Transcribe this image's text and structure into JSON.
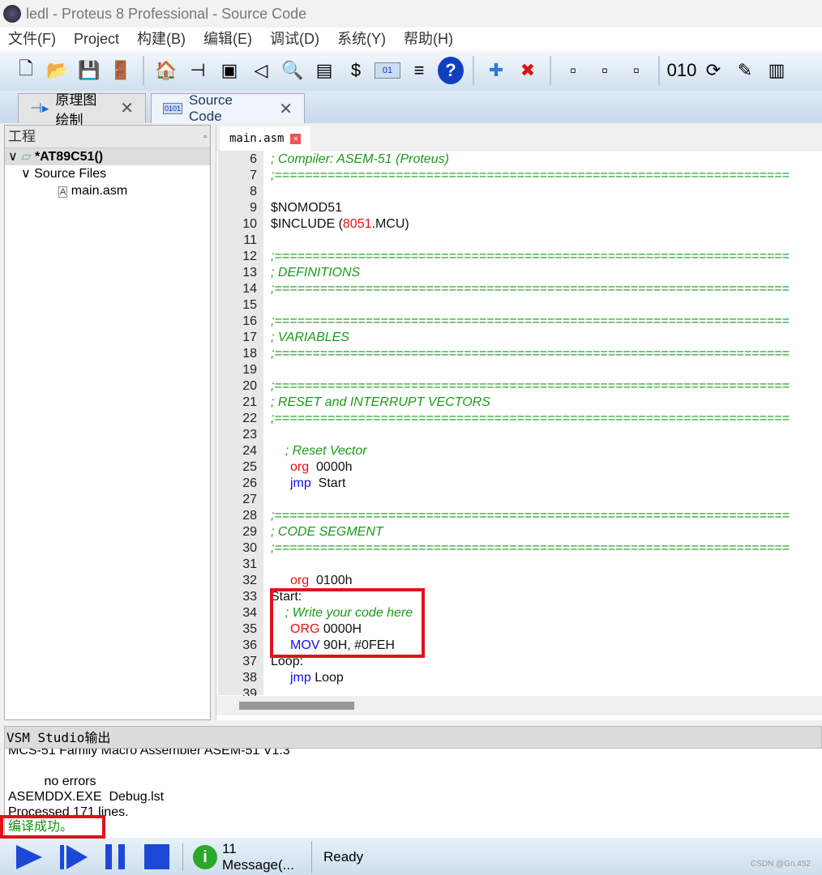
{
  "window": {
    "title": "ledl - Proteus 8 Professional - Source Code"
  },
  "menu": [
    "文件(F)",
    "Project",
    "构建(B)",
    "编辑(E)",
    "调试(D)",
    "系统(Y)",
    "帮助(H)"
  ],
  "toolbar": [
    "new-file",
    "open",
    "save",
    "exit",
    "home",
    "schematic",
    "pcb",
    "3d-view",
    "gerber",
    "bom",
    "design-explorer",
    "source-code",
    "notes",
    "help",
    "add",
    "delete",
    "small-1",
    "small-2",
    "small-3",
    "binary",
    "refresh",
    "tools",
    "chip"
  ],
  "tabs": [
    {
      "label": "原理图绘制",
      "icon": "schematic-icon"
    },
    {
      "label": "Source Code",
      "icon": "binary-icon",
      "active": true
    }
  ],
  "project": {
    "header": "工程",
    "root": "*AT89C51()",
    "folder": "Source Files",
    "file": "main.asm"
  },
  "editor": {
    "file_tab": "main.asm",
    "lines": [
      {
        "n": "6",
        "t": "; Compiler: ASEM-51 (Proteus)",
        "c": "cm"
      },
      {
        "n": "7",
        "t": ";====================================================================",
        "c": "cm"
      },
      {
        "n": "8",
        "t": "",
        "c": ""
      },
      {
        "n": "9",
        "t": "$NOMOD51",
        "c": ""
      },
      {
        "n": "10",
        "t": "$INCLUDE (8051.MCU)",
        "c": ""
      },
      {
        "n": "11",
        "t": "",
        "c": ""
      },
      {
        "n": "12",
        "t": ";====================================================================",
        "c": "cm"
      },
      {
        "n": "13",
        "t": "; DEFINITIONS",
        "c": "cm"
      },
      {
        "n": "14",
        "t": ";====================================================================",
        "c": "cm"
      },
      {
        "n": "15",
        "t": "",
        "c": ""
      },
      {
        "n": "16",
        "t": ";====================================================================",
        "c": "cm"
      },
      {
        "n": "17",
        "t": "; VARIABLES",
        "c": "cm"
      },
      {
        "n": "18",
        "t": ";====================================================================",
        "c": "cm"
      },
      {
        "n": "19",
        "t": "",
        "c": ""
      },
      {
        "n": "20",
        "t": ";====================================================================",
        "c": "cm"
      },
      {
        "n": "21",
        "t": "; RESET and INTERRUPT VECTORS",
        "c": "cm"
      },
      {
        "n": "22",
        "t": ";====================================================================",
        "c": "cm"
      },
      {
        "n": "23",
        "t": "",
        "c": ""
      },
      {
        "n": "24",
        "t": "    ; Reset Vector",
        "c": "cm"
      },
      {
        "n": "25",
        "k": "org",
        "kc": "kw",
        "t": "  0000h"
      },
      {
        "n": "26",
        "k": "jmp",
        "kc": "kb",
        "t": "  Start"
      },
      {
        "n": "27",
        "t": "",
        "c": ""
      },
      {
        "n": "28",
        "t": ";====================================================================",
        "c": "cm"
      },
      {
        "n": "29",
        "t": "; CODE SEGMENT",
        "c": "cm"
      },
      {
        "n": "30",
        "t": ";====================================================================",
        "c": "cm"
      },
      {
        "n": "31",
        "t": "",
        "c": ""
      },
      {
        "n": "32",
        "k": "org",
        "kc": "kw",
        "t": "  0100h"
      },
      {
        "n": "33",
        "t": "Start:",
        "c": ""
      },
      {
        "n": "34",
        "t": "    ; Write your code here",
        "c": "cm"
      },
      {
        "n": "35",
        "k": "ORG",
        "kc": "kw",
        "t": " 0000H"
      },
      {
        "n": "36",
        "k": "MOV",
        "kc": "kb",
        "t": " 90H, #0FEH"
      },
      {
        "n": "37",
        "t": "Loop:",
        "c": ""
      },
      {
        "n": "38",
        "k": "jmp",
        "kc": "kb",
        "t": " Loop"
      },
      {
        "n": "39",
        "t": "",
        "c": ""
      }
    ]
  },
  "output": {
    "header": "VSM Studio输出",
    "lines": [
      "MCS-51 Family Macro Assembler ASEM-51 V1.3",
      "",
      "          no errors",
      "ASEMDDX.EXE  Debug.lst",
      "Processed 171 lines."
    ],
    "success": "编译成功。"
  },
  "status": {
    "messages": "11 Message(...",
    "state": "Ready",
    "watermark": "CSDN @Gn.452"
  }
}
